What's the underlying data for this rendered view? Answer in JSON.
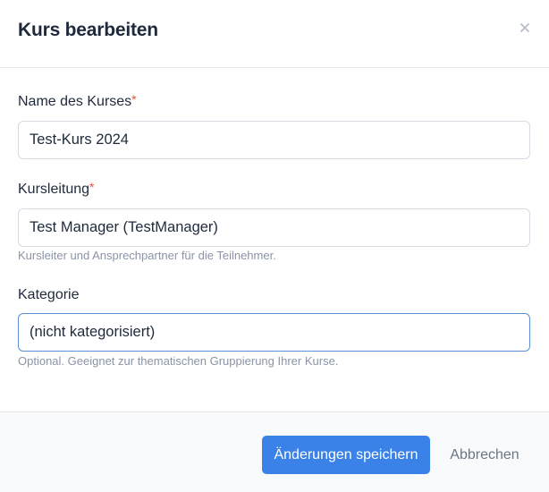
{
  "dialog": {
    "title": "Kurs bearbeiten",
    "close_icon": "close-icon"
  },
  "fields": {
    "name": {
      "label": "Name des Kurses",
      "required_mark": "*",
      "value": "Test-Kurs 2024"
    },
    "leader": {
      "label": "Kursleitung",
      "required_mark": "*",
      "value": "Test Manager (TestManager)",
      "hint": "Kursleiter und Ansprechpartner für die Teilnehmer."
    },
    "category": {
      "label": "Kategorie",
      "value": "(nicht kategorisiert)",
      "hint": "Optional. Geeignet zur thematischen Gruppierung Ihrer Kurse."
    }
  },
  "footer": {
    "save_label": "Änderungen speichern",
    "cancel_label": "Abbrechen"
  },
  "colors": {
    "primary": "#3b82e8",
    "required": "#e5533d",
    "focus_border": "#5b8fd6"
  }
}
